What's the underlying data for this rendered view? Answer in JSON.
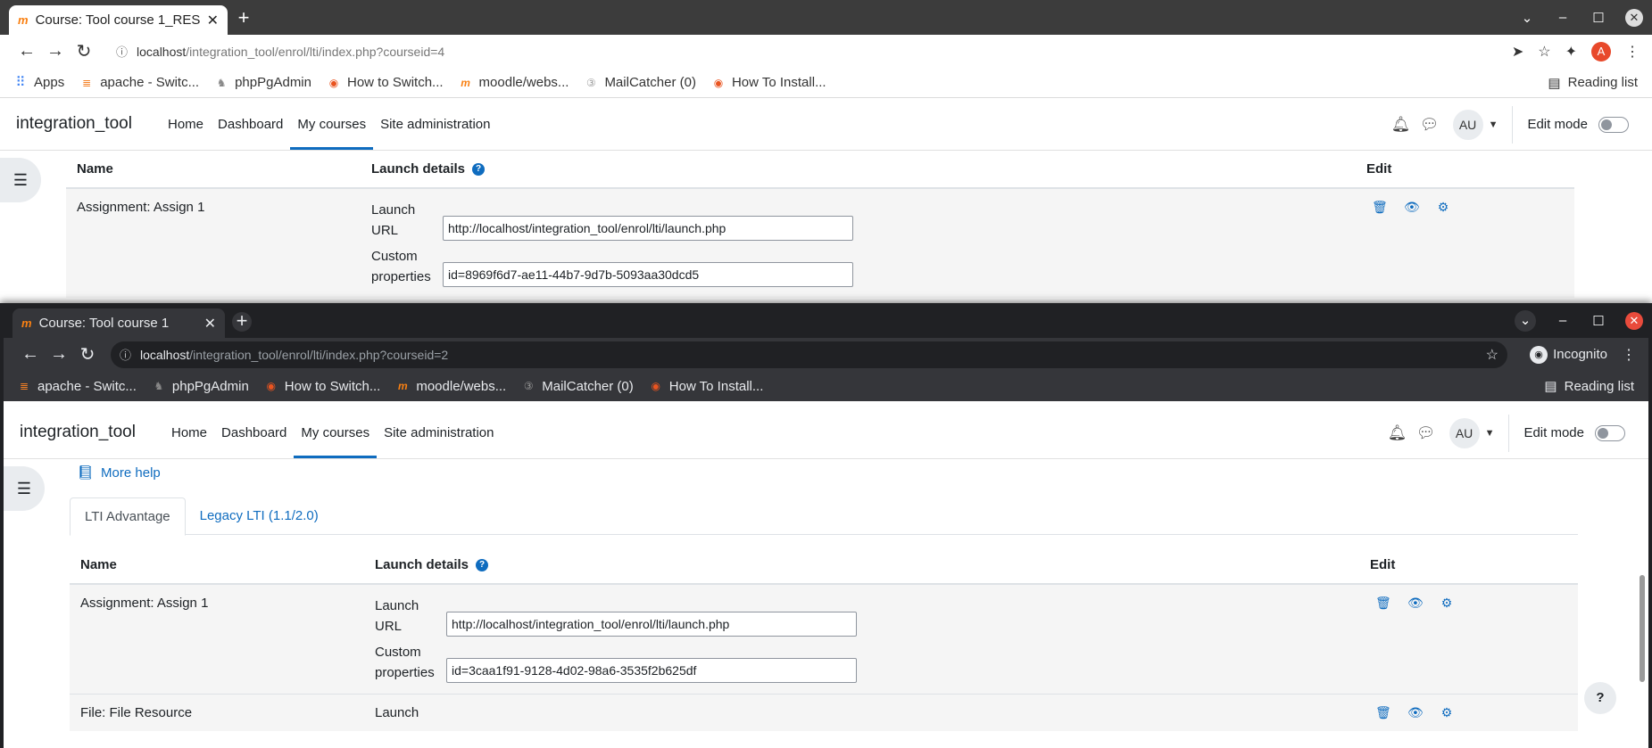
{
  "window1": {
    "tab_title": "Course: Tool course 1_RES",
    "url_host": "localhost",
    "url_path": "/integration_tool/enrol/lti/index.php?courseid=4",
    "profile_initial": "A",
    "bookmarks": [
      "Apps",
      "apache - Switc...",
      "phpPgAdmin",
      "How to Switch...",
      "moodle/webs...",
      "MailCatcher (0)",
      "How To Install..."
    ],
    "reading_list": "Reading list"
  },
  "window2": {
    "tab_title": "Course: Tool course 1",
    "url_host": "localhost",
    "url_path": "/integration_tool/enrol/lti/index.php?courseid=2",
    "incognito": "Incognito",
    "bookmarks": [
      "apache - Switc...",
      "phpPgAdmin",
      "How to Switch...",
      "moodle/webs...",
      "MailCatcher (0)",
      "How To Install..."
    ],
    "reading_list": "Reading list"
  },
  "moodle": {
    "brand": "integration_tool",
    "nav": [
      "Home",
      "Dashboard",
      "My courses",
      "Site administration"
    ],
    "user_initials": "AU",
    "edit_mode": "Edit mode"
  },
  "table": {
    "col_name": "Name",
    "col_launch": "Launch details",
    "col_edit": "Edit",
    "launch_url_label": "Launch URL",
    "custom_props_label": "Custom properties",
    "launch_label": "Launch"
  },
  "win1_rows": [
    {
      "name": "Assignment: Assign 1",
      "launch_url": "http://localhost/integration_tool/enrol/lti/launch.php",
      "custom": "id=8969f6d7-ae11-44b7-9d7b-5093aa30dcd5"
    }
  ],
  "win2_page": {
    "more_help": "More help",
    "tabs": [
      "LTI Advantage",
      "Legacy LTI (1.1/2.0)"
    ],
    "rows": [
      {
        "name": "Assignment: Assign 1",
        "launch_url": "http://localhost/integration_tool/enrol/lti/launch.php",
        "custom": "id=3caa1f91-9128-4d02-98a6-3535f2b625df"
      },
      {
        "name": "File: File Resource"
      }
    ],
    "fab_help": "?"
  },
  "colors": {
    "primary": "#0f6cbf",
    "moodle_orange": "#f98012"
  }
}
